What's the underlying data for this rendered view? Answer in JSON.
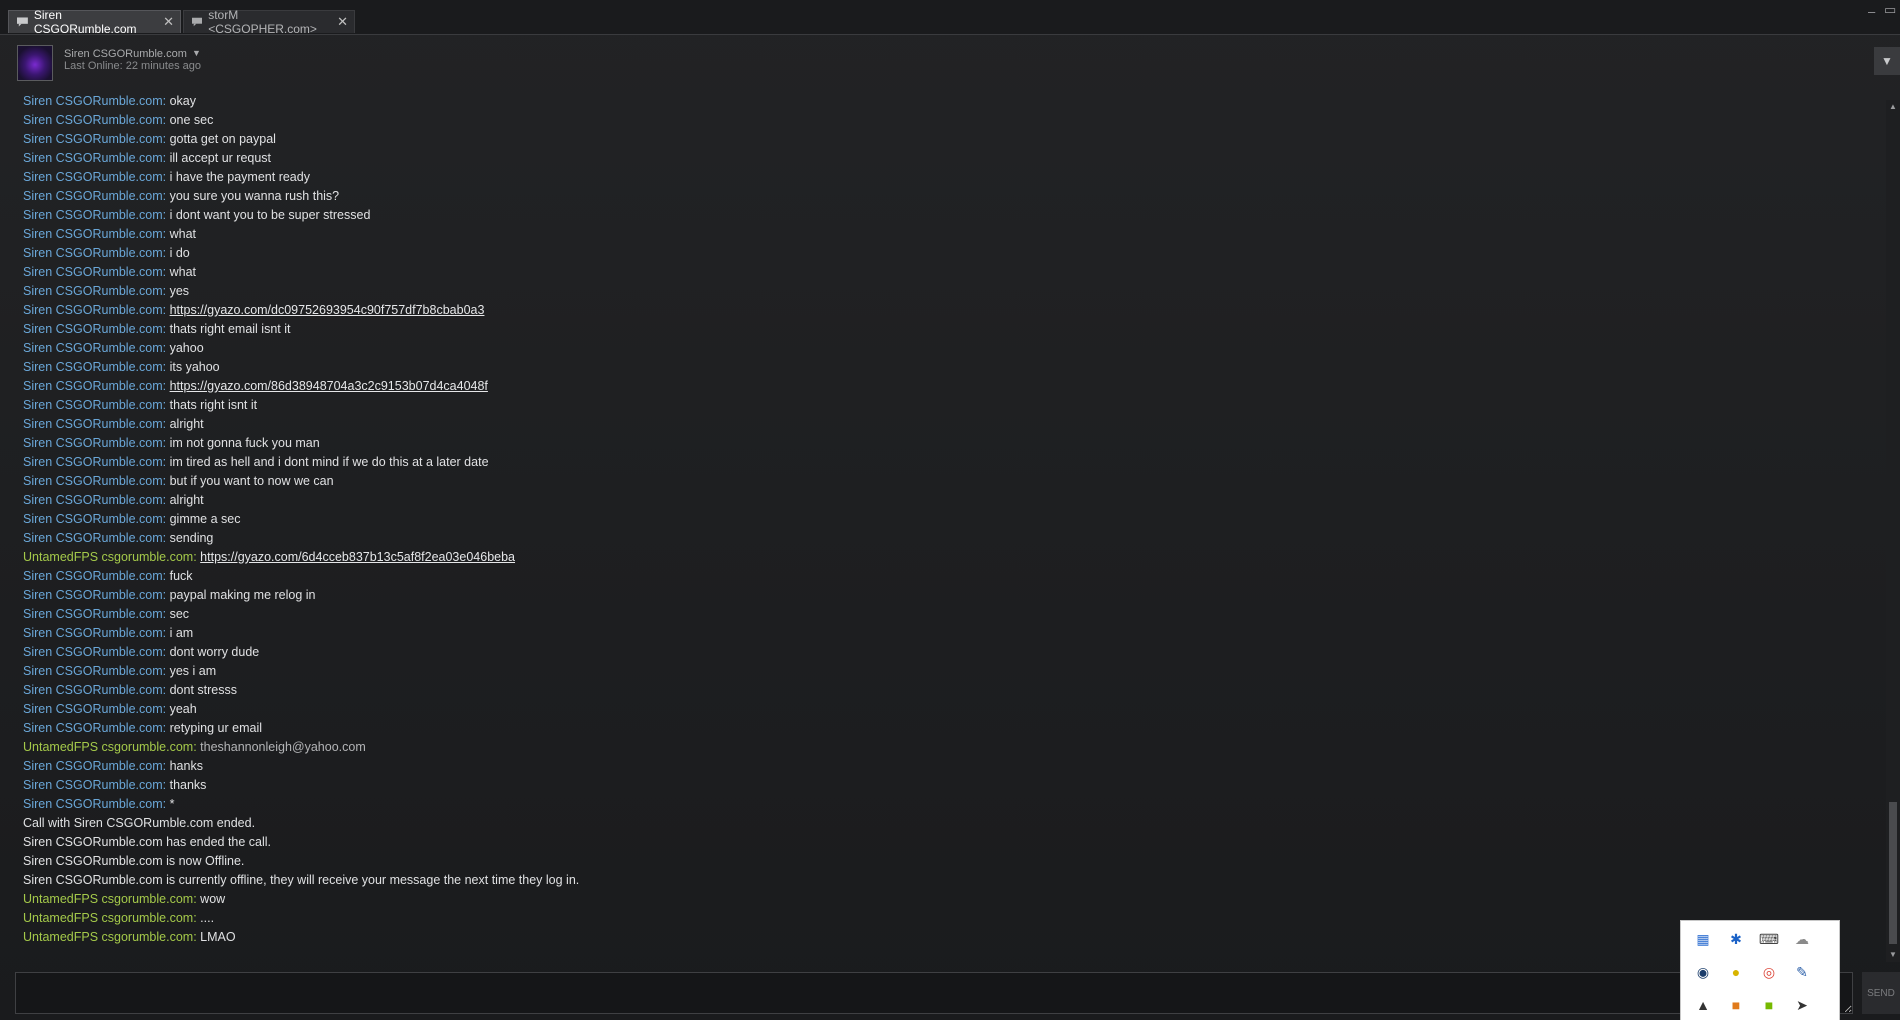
{
  "tabs": [
    {
      "label": "Siren CSGORumble.com",
      "active": true
    },
    {
      "label": "storM <CSGOPHER.com>",
      "active": false
    }
  ],
  "header": {
    "friend_name": "Siren CSGORumble.com",
    "last_online": "Last Online: 22 minutes ago",
    "dropdown_glyph": "▼"
  },
  "window_controls": {
    "minimize": "–",
    "restore": "▭"
  },
  "messages": [
    {
      "sender": "Siren CSGORumble.com:",
      "text": "okay",
      "kind": "text",
      "who": "siren"
    },
    {
      "sender": "Siren CSGORumble.com:",
      "text": "one sec",
      "kind": "text",
      "who": "siren"
    },
    {
      "sender": "Siren CSGORumble.com:",
      "text": "gotta get on paypal",
      "kind": "text",
      "who": "siren"
    },
    {
      "sender": "Siren CSGORumble.com:",
      "text": "ill accept ur requst",
      "kind": "text",
      "who": "siren"
    },
    {
      "sender": "Siren CSGORumble.com:",
      "text": "i have the payment ready",
      "kind": "text",
      "who": "siren"
    },
    {
      "sender": "Siren CSGORumble.com:",
      "text": "you sure you wanna rush this?",
      "kind": "text",
      "who": "siren"
    },
    {
      "sender": "Siren CSGORumble.com:",
      "text": "i dont want you to be super stressed",
      "kind": "text",
      "who": "siren"
    },
    {
      "sender": "Siren CSGORumble.com:",
      "text": "what",
      "kind": "text",
      "who": "siren"
    },
    {
      "sender": "Siren CSGORumble.com:",
      "text": "i do",
      "kind": "text",
      "who": "siren"
    },
    {
      "sender": "Siren CSGORumble.com:",
      "text": "what",
      "kind": "text",
      "who": "siren"
    },
    {
      "sender": "Siren CSGORumble.com:",
      "text": "yes",
      "kind": "text",
      "who": "siren"
    },
    {
      "sender": "Siren CSGORumble.com:",
      "text": "https://gyazo.com/dc09752693954c90f757df7b8cbab0a3",
      "kind": "link",
      "who": "siren"
    },
    {
      "sender": "Siren CSGORumble.com:",
      "text": "thats right email isnt it",
      "kind": "text",
      "who": "siren"
    },
    {
      "sender": "Siren CSGORumble.com:",
      "text": "yahoo",
      "kind": "text",
      "who": "siren"
    },
    {
      "sender": "Siren CSGORumble.com:",
      "text": "its yahoo",
      "kind": "text",
      "who": "siren"
    },
    {
      "sender": "Siren CSGORumble.com:",
      "text": "https://gyazo.com/86d38948704a3c2c9153b07d4ca4048f",
      "kind": "link",
      "who": "siren"
    },
    {
      "sender": "Siren CSGORumble.com:",
      "text": "thats right isnt it",
      "kind": "text",
      "who": "siren"
    },
    {
      "sender": "Siren CSGORumble.com:",
      "text": "alright",
      "kind": "text",
      "who": "siren"
    },
    {
      "sender": "Siren CSGORumble.com:",
      "text": "im not gonna fuck you man",
      "kind": "text",
      "who": "siren"
    },
    {
      "sender": "Siren CSGORumble.com:",
      "text": "im tired as hell and i dont mind if we do this at a later date",
      "kind": "text",
      "who": "siren"
    },
    {
      "sender": "Siren CSGORumble.com:",
      "text": "but if you want to now we can",
      "kind": "text",
      "who": "siren"
    },
    {
      "sender": "Siren CSGORumble.com:",
      "text": "alright",
      "kind": "text",
      "who": "siren"
    },
    {
      "sender": "Siren CSGORumble.com:",
      "text": "gimme a sec",
      "kind": "text",
      "who": "siren"
    },
    {
      "sender": "Siren CSGORumble.com:",
      "text": "sending",
      "kind": "text",
      "who": "siren"
    },
    {
      "sender": "UntamedFPS csgorumble.com:",
      "text": "https://gyazo.com/6d4cceb837b13c5af8f2ea03e046beba",
      "kind": "link",
      "who": "untamed"
    },
    {
      "sender": "Siren CSGORumble.com:",
      "text": "fuck",
      "kind": "text",
      "who": "siren"
    },
    {
      "sender": "Siren CSGORumble.com:",
      "text": "paypal making me relog in",
      "kind": "text",
      "who": "siren"
    },
    {
      "sender": "Siren CSGORumble.com:",
      "text": "sec",
      "kind": "text",
      "who": "siren"
    },
    {
      "sender": "Siren CSGORumble.com:",
      "text": "i am",
      "kind": "text",
      "who": "siren"
    },
    {
      "sender": "Siren CSGORumble.com:",
      "text": "dont worry dude",
      "kind": "text",
      "who": "siren"
    },
    {
      "sender": "Siren CSGORumble.com:",
      "text": "yes i am",
      "kind": "text",
      "who": "siren"
    },
    {
      "sender": "Siren CSGORumble.com:",
      "text": "dont stresss",
      "kind": "text",
      "who": "siren"
    },
    {
      "sender": "Siren CSGORumble.com:",
      "text": "yeah",
      "kind": "text",
      "who": "siren"
    },
    {
      "sender": "Siren CSGORumble.com:",
      "text": "retyping ur email",
      "kind": "text",
      "who": "siren"
    },
    {
      "sender": "UntamedFPS csgorumble.com:",
      "text": "theshannonleigh@yahoo.com",
      "kind": "email",
      "who": "untamed"
    },
    {
      "sender": "Siren CSGORumble.com:",
      "text": "hanks",
      "kind": "text",
      "who": "siren"
    },
    {
      "sender": "Siren CSGORumble.com:",
      "text": "thanks",
      "kind": "text",
      "who": "siren"
    },
    {
      "sender": "Siren CSGORumble.com:",
      "text": "*",
      "kind": "text",
      "who": "siren"
    },
    {
      "sender": "",
      "text": "Call with Siren CSGORumble.com ended.",
      "kind": "system",
      "who": "system"
    },
    {
      "sender": "",
      "text": "Siren CSGORumble.com has ended the call.",
      "kind": "system",
      "who": "system"
    },
    {
      "sender": "",
      "text": "Siren CSGORumble.com is now Offline.",
      "kind": "system",
      "who": "system"
    },
    {
      "sender": "",
      "text": "Siren CSGORumble.com is currently offline, they will receive your message the next time they log in.",
      "kind": "system",
      "who": "system"
    },
    {
      "sender": "UntamedFPS csgorumble.com:",
      "text": "wow",
      "kind": "text",
      "who": "untamed"
    },
    {
      "sender": "UntamedFPS csgorumble.com:",
      "text": "....",
      "kind": "text",
      "who": "untamed"
    },
    {
      "sender": "UntamedFPS csgorumble.com:",
      "text": "LMAO",
      "kind": "text",
      "who": "untamed"
    }
  ],
  "input": {
    "value": "",
    "placeholder": ""
  },
  "send_label": "SEND",
  "scrollbar": {
    "up_glyph": "▲",
    "down_glyph": "▼",
    "scroll_position_fraction": 0.94
  },
  "tray_icons": [
    {
      "name": "network-app-icon",
      "glyph": "▦",
      "color": "#2f6fd1"
    },
    {
      "name": "bluetooth-icon",
      "glyph": "✱",
      "color": "#1b62c7"
    },
    {
      "name": "keyboard-mouse-icon",
      "glyph": "⌨",
      "color": "#444444"
    },
    {
      "name": "onedrive-icon",
      "glyph": "☁",
      "color": "#8a8a8a"
    },
    {
      "name": "steam-icon",
      "glyph": "◉",
      "color": "#1b3d6b"
    },
    {
      "name": "norton-icon",
      "glyph": "●",
      "color": "#d8b400"
    },
    {
      "name": "chrome-icon",
      "glyph": "◎",
      "color": "#db4437"
    },
    {
      "name": "pen-tablet-icon",
      "glyph": "✎",
      "color": "#2a5ea8"
    },
    {
      "name": "flame-icon",
      "glyph": "▲",
      "color": "#333333"
    },
    {
      "name": "orange-app-icon",
      "glyph": "■",
      "color": "#e07a1b"
    },
    {
      "name": "nvidia-icon",
      "glyph": "■",
      "color": "#76b900"
    },
    {
      "name": "arrow-app-icon",
      "glyph": "➤",
      "color": "#333333"
    }
  ],
  "colors": {
    "siren": "#6aa7d8",
    "untamed": "#a4c94a",
    "text": "#e0e1e3",
    "background": "#1d1e20"
  }
}
